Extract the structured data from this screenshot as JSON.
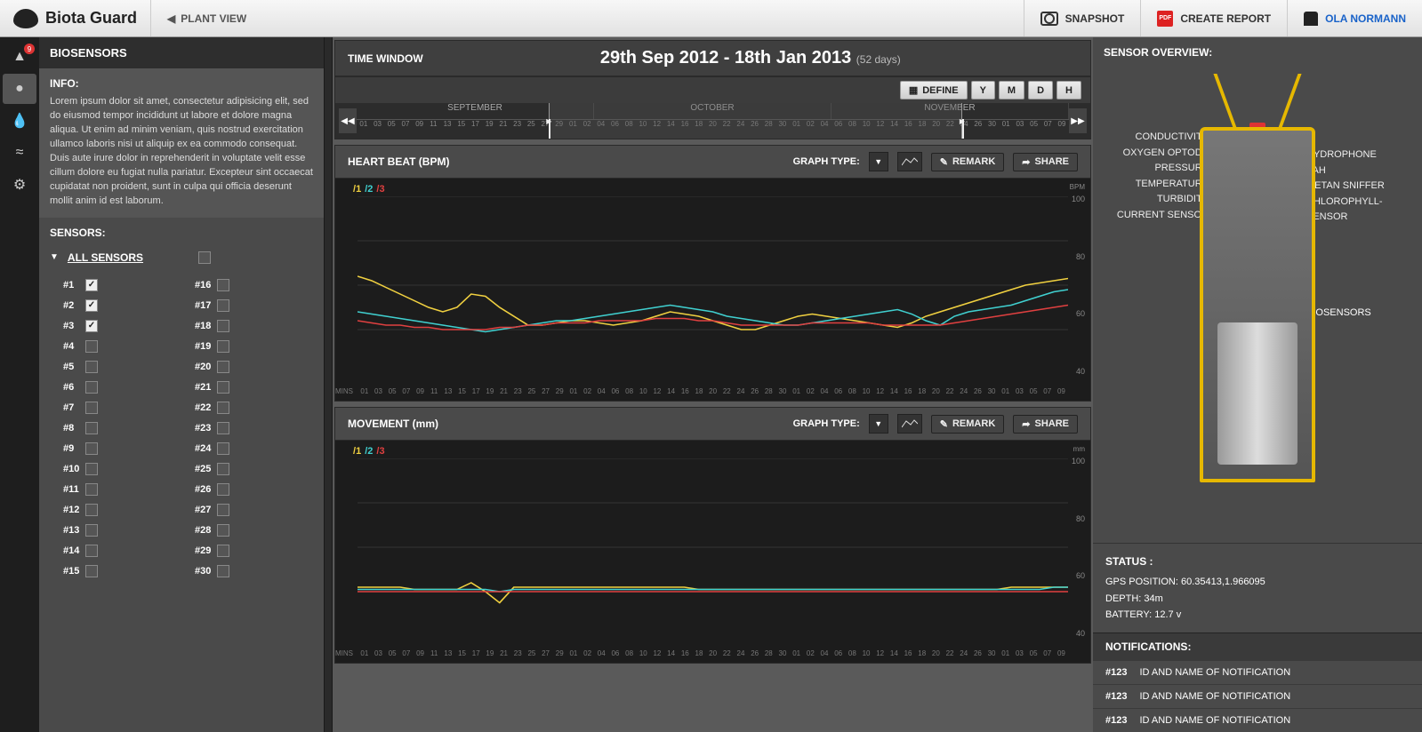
{
  "app": {
    "name": "Biota Guard",
    "nav_back": "PLANT VIEW"
  },
  "topbar": {
    "snapshot": "SNAPSHOT",
    "report": "CREATE REPORT",
    "user": "OLA NORMANN"
  },
  "left": {
    "title": "BIOSENSORS",
    "info_head": "INFO:",
    "info_text": "Lorem ipsum dolor sit amet, consectetur adipisicing elit, sed do eiusmod tempor incididunt ut labore et dolore magna aliqua. Ut enim ad minim veniam, quis nostrud exercitation ullamco laboris nisi ut aliquip ex ea commodo consequat. Duis aute irure dolor in reprehenderit in voluptate velit esse cillum dolore eu fugiat nulla pariatur. Excepteur sint occaecat cupidatat non proident, sunt in culpa qui officia deserunt mollit anim id est laborum.",
    "sensors_head": "SENSORS:",
    "all_sensors": "ALL SENSORS",
    "sensors": [
      {
        "n": "#1",
        "c": true
      },
      {
        "n": "#16",
        "c": false
      },
      {
        "n": "#2",
        "c": true
      },
      {
        "n": "#17",
        "c": false
      },
      {
        "n": "#3",
        "c": true
      },
      {
        "n": "#18",
        "c": false
      },
      {
        "n": "#4",
        "c": false
      },
      {
        "n": "#19",
        "c": false
      },
      {
        "n": "#5",
        "c": false
      },
      {
        "n": "#20",
        "c": false
      },
      {
        "n": "#6",
        "c": false
      },
      {
        "n": "#21",
        "c": false
      },
      {
        "n": "#7",
        "c": false
      },
      {
        "n": "#22",
        "c": false
      },
      {
        "n": "#8",
        "c": false
      },
      {
        "n": "#23",
        "c": false
      },
      {
        "n": "#9",
        "c": false
      },
      {
        "n": "#24",
        "c": false
      },
      {
        "n": "#10",
        "c": false
      },
      {
        "n": "#25",
        "c": false
      },
      {
        "n": "#11",
        "c": false
      },
      {
        "n": "#26",
        "c": false
      },
      {
        "n": "#12",
        "c": false
      },
      {
        "n": "#27",
        "c": false
      },
      {
        "n": "#13",
        "c": false
      },
      {
        "n": "#28",
        "c": false
      },
      {
        "n": "#14",
        "c": false
      },
      {
        "n": "#29",
        "c": false
      },
      {
        "n": "#15",
        "c": false
      },
      {
        "n": "#30",
        "c": false
      }
    ]
  },
  "timewindow": {
    "label": "TIME WINDOW",
    "range": "29th Sep 2012 - 18th Jan 2013",
    "days": "(52 days)",
    "define": "DEFINE",
    "y": "Y",
    "m": "M",
    "d": "D",
    "h": "H",
    "months": [
      "SEPTEMBER",
      "OCTOBER",
      "NOVEMBER"
    ],
    "ticks": [
      "01",
      "03",
      "05",
      "07",
      "09",
      "11",
      "13",
      "15",
      "17",
      "19",
      "21",
      "23",
      "25",
      "27",
      "29",
      "01",
      "02",
      "04",
      "06",
      "08",
      "10",
      "12",
      "14",
      "16",
      "18",
      "20",
      "22",
      "24",
      "26",
      "28",
      "30",
      "01",
      "02",
      "04",
      "06",
      "08",
      "10",
      "12",
      "14",
      "16",
      "18",
      "20",
      "22",
      "24",
      "26",
      "30",
      "01",
      "03",
      "05",
      "07",
      "09"
    ]
  },
  "graphs": {
    "type_label": "GRAPH TYPE:",
    "remark": "REMARK",
    "share": "SHARE",
    "mins": "MINS",
    "legend": [
      "1",
      "2",
      "3"
    ]
  },
  "chart_data": [
    {
      "type": "line",
      "title": "HEART BEAT (BPM)",
      "yunit": "BPM",
      "ylim": [
        20,
        100
      ],
      "yticks": [
        100,
        80,
        60,
        40
      ],
      "x": [
        "01",
        "03",
        "05",
        "07",
        "09",
        "11",
        "13",
        "15",
        "17",
        "19",
        "21",
        "23",
        "25",
        "27",
        "29",
        "01",
        "02",
        "04",
        "06",
        "08",
        "10",
        "12",
        "14",
        "16",
        "18",
        "20",
        "22",
        "24",
        "26",
        "28",
        "30",
        "01",
        "02",
        "04",
        "06",
        "08",
        "10",
        "12",
        "14",
        "16",
        "18",
        "20",
        "22",
        "24",
        "26",
        "30",
        "01",
        "03",
        "05",
        "07",
        "09"
      ],
      "series": [
        {
          "name": "1",
          "values": [
            64,
            62,
            59,
            56,
            53,
            50,
            48,
            50,
            56,
            55,
            50,
            46,
            42,
            42,
            43,
            44,
            44,
            43,
            42,
            43,
            44,
            46,
            48,
            47,
            46,
            44,
            42,
            40,
            40,
            42,
            44,
            46,
            47,
            46,
            45,
            44,
            43,
            42,
            41,
            43,
            46,
            48,
            50,
            52,
            54,
            56,
            58,
            60,
            61,
            62,
            63
          ]
        },
        {
          "name": "2",
          "values": [
            48,
            47,
            46,
            45,
            44,
            43,
            42,
            41,
            40,
            39,
            40,
            41,
            42,
            43,
            44,
            44,
            45,
            46,
            47,
            48,
            49,
            50,
            51,
            50,
            49,
            48,
            46,
            45,
            44,
            43,
            42,
            42,
            43,
            44,
            45,
            46,
            47,
            48,
            49,
            47,
            44,
            42,
            46,
            48,
            49,
            50,
            51,
            53,
            55,
            57,
            58
          ]
        },
        {
          "name": "3",
          "values": [
            44,
            43,
            42,
            42,
            41,
            41,
            40,
            40,
            40,
            40,
            41,
            41,
            42,
            42,
            43,
            43,
            43,
            44,
            44,
            44,
            44,
            45,
            45,
            45,
            44,
            44,
            43,
            42,
            42,
            42,
            42,
            42,
            43,
            43,
            43,
            43,
            43,
            42,
            42,
            42,
            42,
            42,
            43,
            44,
            45,
            46,
            47,
            48,
            49,
            50,
            51
          ]
        }
      ]
    },
    {
      "type": "line",
      "title": "MOVEMENT (mm)",
      "yunit": "mm",
      "ylim": [
        20,
        100
      ],
      "yticks": [
        100,
        80,
        60,
        40
      ],
      "x": [
        "01",
        "03",
        "05",
        "07",
        "09",
        "11",
        "13",
        "15",
        "17",
        "19",
        "21",
        "23",
        "25",
        "27",
        "29",
        "01",
        "02",
        "04",
        "06",
        "08",
        "10",
        "12",
        "14",
        "16",
        "18",
        "20",
        "22",
        "24",
        "26",
        "28",
        "30",
        "01",
        "02",
        "04",
        "06",
        "08",
        "10",
        "12",
        "14",
        "16",
        "18",
        "20",
        "22",
        "24",
        "26",
        "30",
        "01",
        "03",
        "05",
        "07",
        "09"
      ],
      "series": [
        {
          "name": "1",
          "values": [
            42,
            42,
            42,
            42,
            41,
            41,
            41,
            41,
            44,
            40,
            35,
            42,
            42,
            42,
            42,
            42,
            42,
            42,
            42,
            42,
            42,
            42,
            42,
            42,
            41,
            41,
            41,
            41,
            41,
            41,
            41,
            41,
            41,
            41,
            41,
            41,
            41,
            41,
            41,
            41,
            41,
            41,
            41,
            41,
            41,
            41,
            42,
            42,
            42,
            42,
            42
          ]
        },
        {
          "name": "2",
          "values": [
            41,
            41,
            41,
            41,
            41,
            41,
            41,
            41,
            41,
            41,
            40,
            41,
            41,
            41,
            41,
            41,
            41,
            41,
            41,
            41,
            41,
            41,
            41,
            41,
            41,
            41,
            41,
            41,
            41,
            41,
            41,
            41,
            41,
            41,
            41,
            41,
            41,
            41,
            41,
            41,
            41,
            41,
            41,
            41,
            41,
            41,
            41,
            41,
            41,
            42,
            42
          ]
        },
        {
          "name": "3",
          "values": [
            40,
            40,
            40,
            40,
            40,
            40,
            40,
            40,
            40,
            40,
            40,
            40,
            40,
            40,
            40,
            40,
            40,
            40,
            40,
            40,
            40,
            40,
            40,
            40,
            40,
            40,
            40,
            40,
            40,
            40,
            40,
            40,
            40,
            40,
            40,
            40,
            40,
            40,
            40,
            40,
            40,
            40,
            40,
            40,
            40,
            40,
            40,
            40,
            40,
            40,
            40
          ]
        }
      ]
    }
  ],
  "right": {
    "title": "SENSOR OVERVIEW:",
    "left_labels": [
      "CONDUCTIVITY",
      "OXYGEN OPTODE",
      "PRESSURE",
      "TEMPERATURE",
      "TURBIDITY",
      "CURRENT SENSOR"
    ],
    "right_labels": [
      "HYDROPHONE",
      "PAH",
      "METAN SNIFFER",
      "CHLOROPHYLL-",
      "SENSOR"
    ],
    "bio_label": "BIOSENSORS",
    "status_head": "STATUS :",
    "gps_label": "GPS POSITION:",
    "gps_val": "60.35413,1.966095",
    "depth_label": "DEPTH:",
    "depth_val": "34m",
    "batt_label": "BATTERY:",
    "batt_val": "12.7 v",
    "notif_head": "NOTIFICATIONS:",
    "notifs": [
      {
        "id": "#123",
        "text": "ID AND NAME OF NOTIFICATION"
      },
      {
        "id": "#123",
        "text": "ID AND NAME OF NOTIFICATION"
      },
      {
        "id": "#123",
        "text": "ID AND NAME OF NOTIFICATION"
      }
    ]
  }
}
